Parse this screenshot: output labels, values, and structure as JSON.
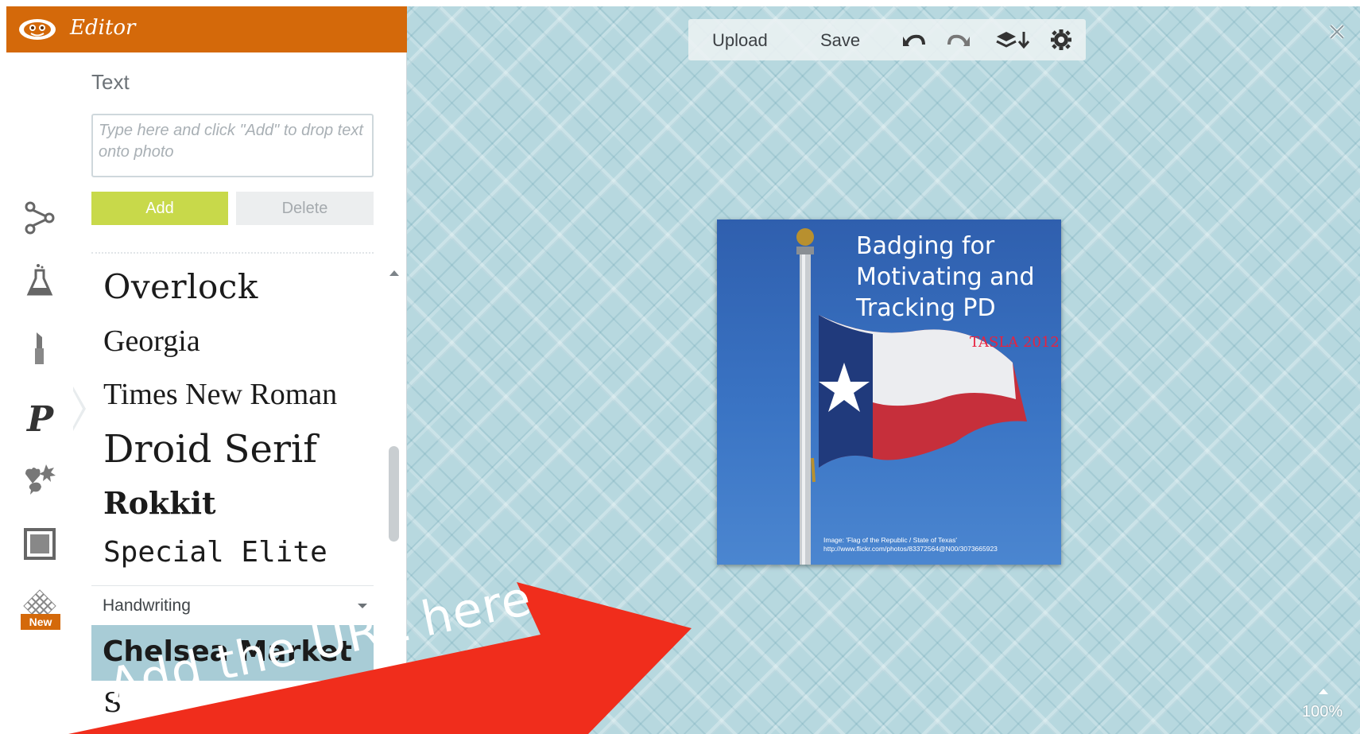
{
  "header": {
    "title": "Editor"
  },
  "text_panel": {
    "section_label": "Text",
    "input_placeholder": "Type here and click \"Add\" to drop text onto photo",
    "add_label": "Add",
    "delete_label": "Delete"
  },
  "fonts": {
    "items": [
      "Overlock",
      "Georgia",
      "Times New Roman",
      "Droid Serif",
      "Rokkit",
      "Special Elite"
    ],
    "category": "Handwriting",
    "selected": "Chelsea Market",
    "next_partial": "S"
  },
  "toolbar": {
    "upload_label": "Upload",
    "save_label": "Save"
  },
  "photo": {
    "title": "Badging for Motivating and Tracking PD",
    "subtitle": "TASLA 2012",
    "credit_line1": "Image: 'Flag of the Republic / State of Texas'",
    "credit_line2": "http://www.flickr.com/photos/83372564@N00/3073665923"
  },
  "zoom": {
    "level": "100%"
  },
  "annotation": {
    "text": "Add the URL here"
  },
  "colors": {
    "header": "#d4690a",
    "add_button": "#c8d94a",
    "selected_font_bg": "#a8ccd6",
    "canvas": "#b7d8df",
    "annotation_arrow": "#f02d1c"
  },
  "icons": {
    "rail": [
      "share-icon",
      "effects-flask-icon",
      "touch-up-lipstick-icon",
      "text-p-icon",
      "overlays-icon",
      "frames-icon",
      "textures-icon"
    ],
    "toolbar": [
      "undo-icon",
      "redo-icon",
      "layers-icon",
      "gear-icon"
    ]
  }
}
